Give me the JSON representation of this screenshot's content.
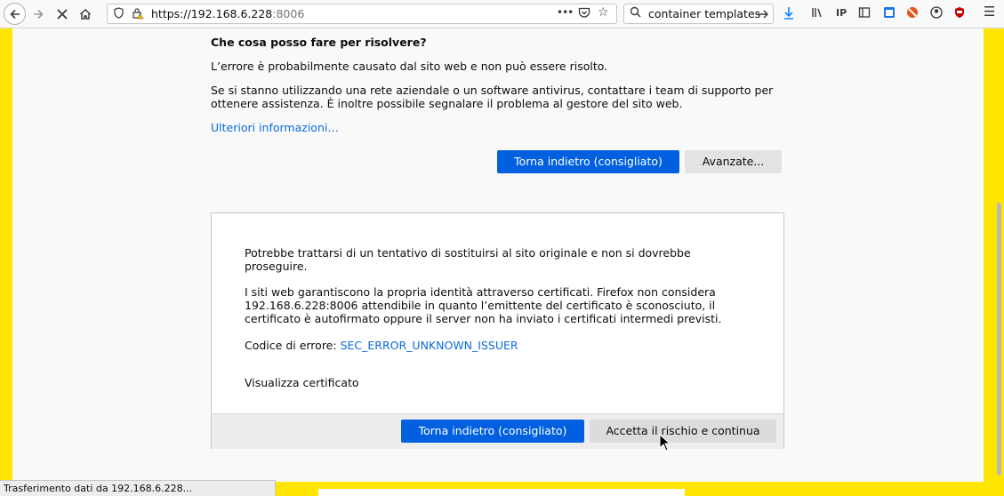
{
  "browser": {
    "url_host": "https://192.168.6.228",
    "url_port": ":8006",
    "url_menu": "•••",
    "search_text": "container templates",
    "status_text": "Trasferimento dati da 192.168.6.228..."
  },
  "page": {
    "heading": "Che cosa posso fare per risolvere?",
    "para1": "L’errore è probabilmente causato dal sito web e non può essere risolto.",
    "para2_line1": "Se si stanno utilizzando una rete aziendale o un software antivirus, contattare i team di supporto per",
    "para2_line2": "ottenere assistenza. È inoltre possibile segnalare il problema al gestore del sito web.",
    "learn_more": "Ulteriori informazioni…",
    "back_button": "Torna indietro (consigliato)",
    "advanced_button": "Avanzate..."
  },
  "advanced": {
    "line1": "Potrebbe trattarsi di un tentativo di sostituirsi al sito originale e non si dovrebbe",
    "line2": "proseguire.",
    "line3": "I siti web garantiscono la propria identità attraverso certificati. Firefox non considera",
    "line4": "192.168.6.228:8006 attendibile in quanto l’emittente del certificato è sconosciuto, il",
    "line5": "certificato è autofirmato oppure il server non ha inviato i certificati intermedi previsti.",
    "error_code_label": "Codice di errore:",
    "error_code": "SEC_ERROR_UNKNOWN_ISSUER",
    "view_certificate": "Visualizza certificato",
    "back_button": "Torna indietro (consigliato)",
    "accept_button": "Accetta il rischio e continua"
  },
  "colors": {
    "primary": "#0060df",
    "link": "#0a6bd9",
    "page_border": "#ffe600"
  }
}
